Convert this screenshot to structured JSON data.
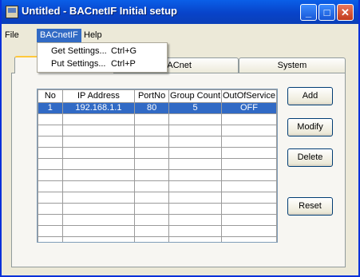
{
  "window": {
    "title": "Untitled - BACnetIF Initial setup",
    "minimize_glyph": "_",
    "maximize_glyph": "□",
    "close_glyph": "✕"
  },
  "menubar": {
    "items": [
      {
        "label": "File"
      },
      {
        "label": "BACnetIF",
        "active": true
      },
      {
        "label": "Help"
      }
    ]
  },
  "dropdown": {
    "items": [
      {
        "label": "Get Settings...",
        "shortcut": "Ctrl+G"
      },
      {
        "label": "Put Settings...",
        "shortcut": "Ctrl+P"
      }
    ]
  },
  "tabs": [
    {
      "label": "",
      "selected": true
    },
    {
      "label": "BACnet",
      "selected": false
    },
    {
      "label": "System",
      "selected": false
    }
  ],
  "table": {
    "columns": [
      "No",
      "IP Address",
      "PortNo",
      "Group Count",
      "OutOfService"
    ],
    "rows": [
      {
        "no": "1",
        "ip": "192.168.1.1",
        "port": "80",
        "group_count": "5",
        "out_of_service": "OFF",
        "selected": true
      }
    ]
  },
  "buttons": {
    "add": "Add",
    "modify": "Modify",
    "delete": "Delete",
    "reset": "Reset"
  },
  "colors": {
    "titlebar": "#0a5fe8",
    "selection": "#316ac5",
    "close_button": "#e8785c",
    "face": "#ece9d8"
  }
}
